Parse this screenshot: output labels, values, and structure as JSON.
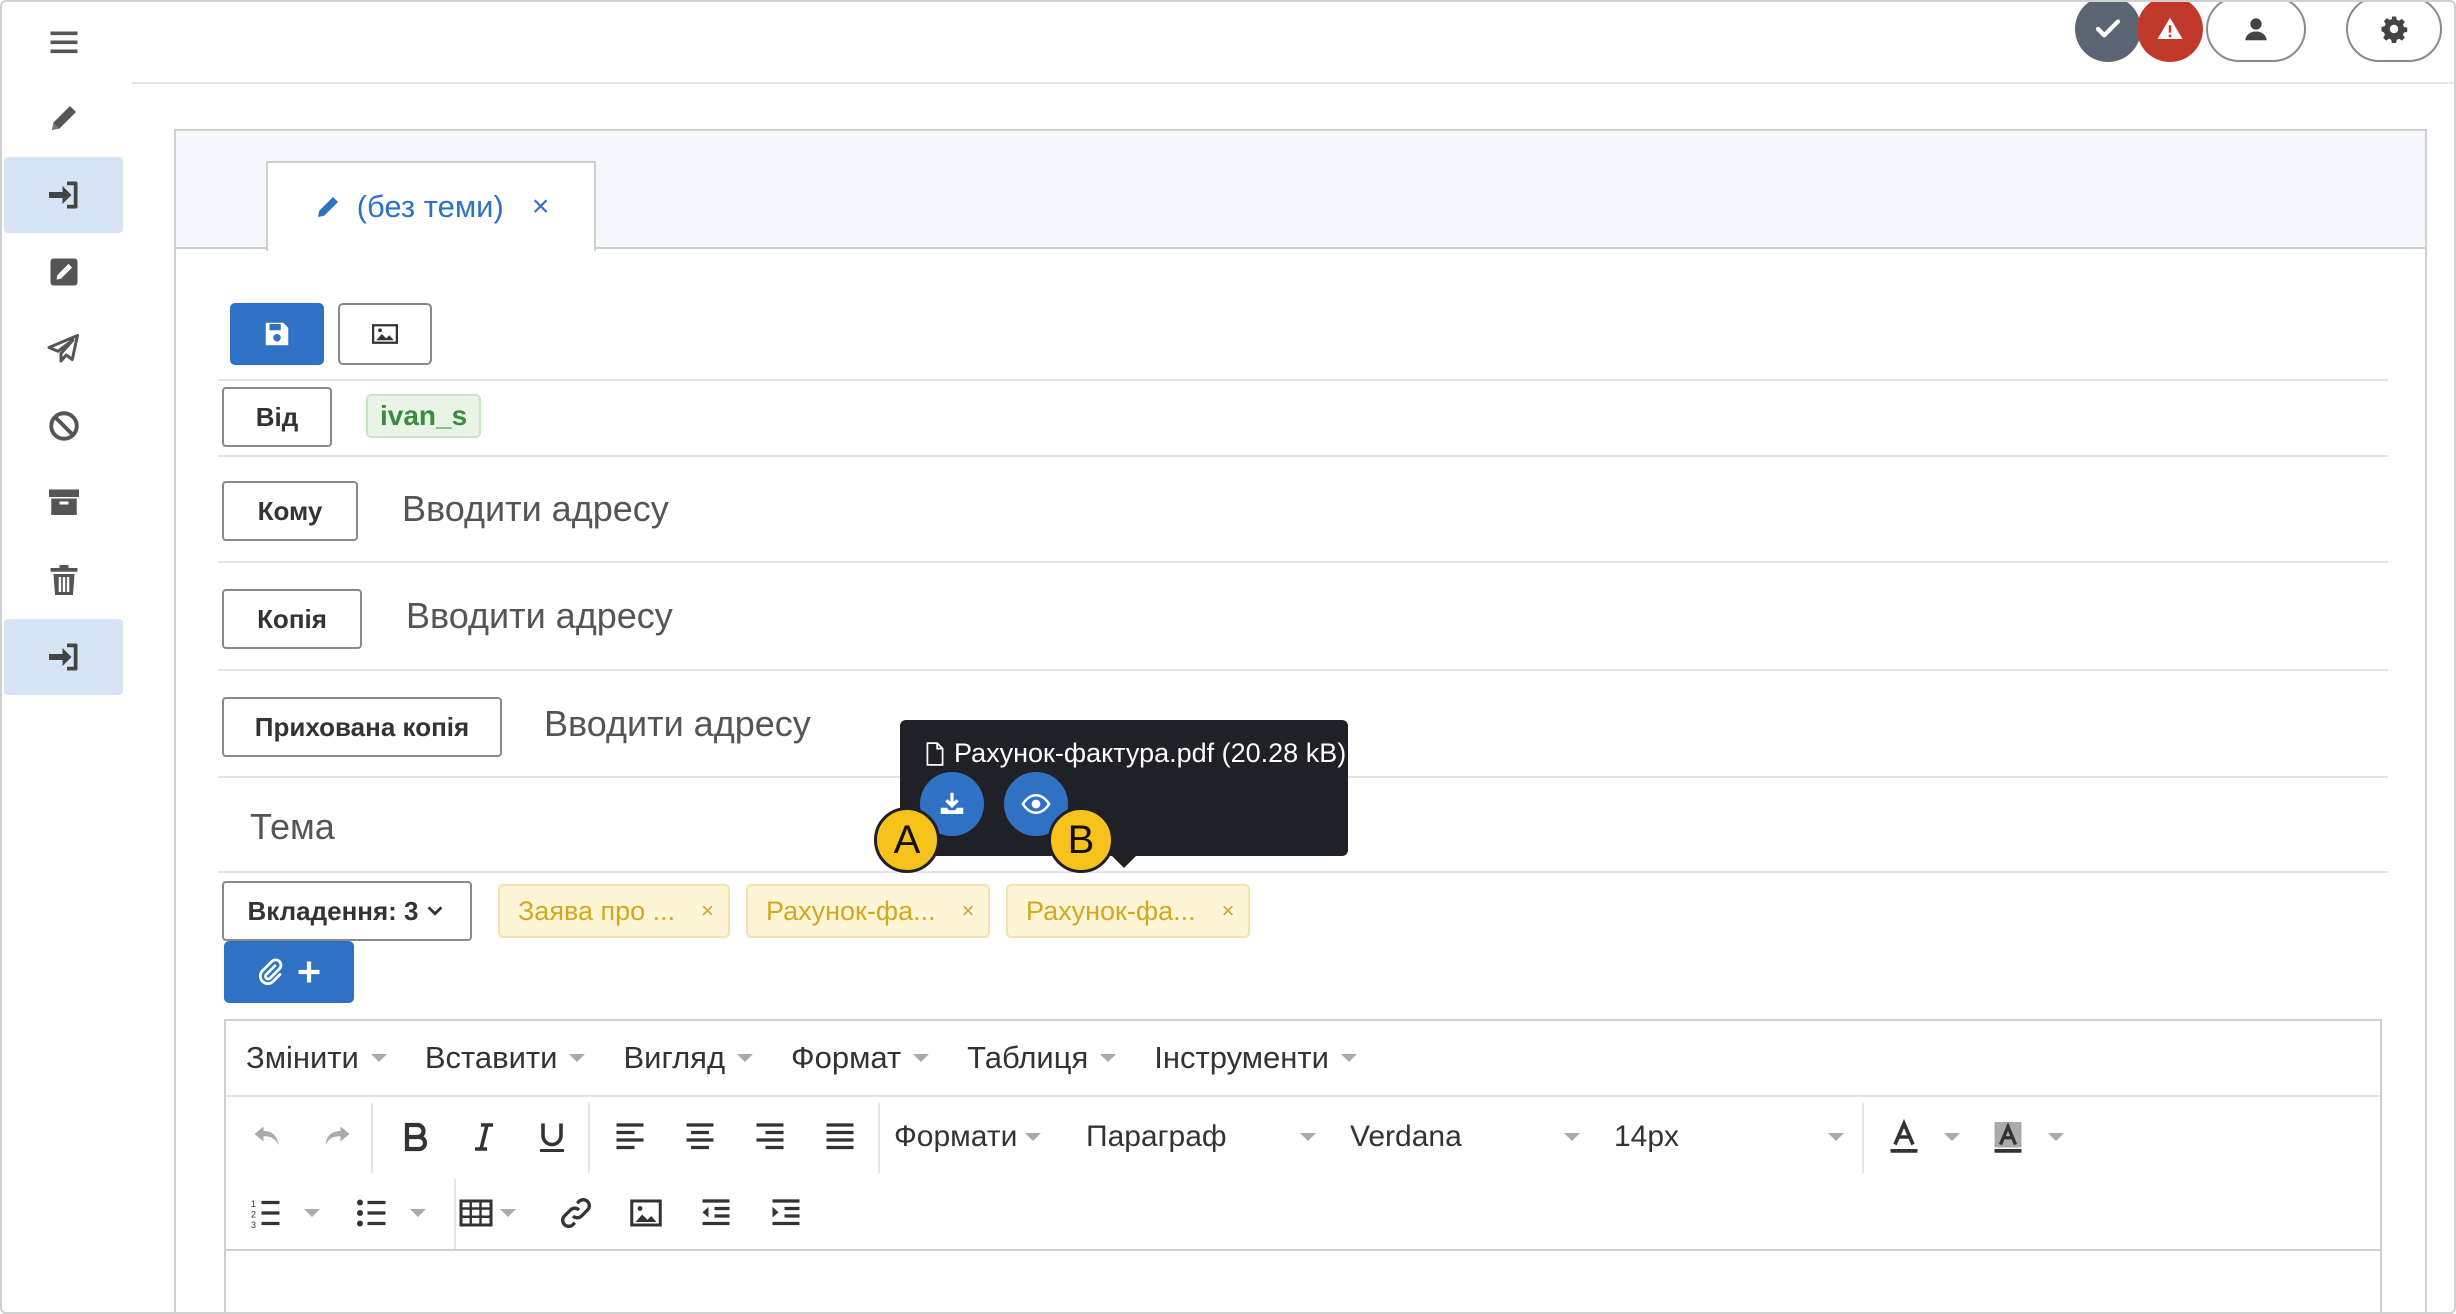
{
  "sidebar": {
    "items": [
      {
        "icon": "hamburger-icon"
      },
      {
        "icon": "pencil-icon"
      },
      {
        "icon": "sign-in-icon"
      },
      {
        "icon": "edit-square-icon"
      },
      {
        "icon": "paper-plane-icon"
      },
      {
        "icon": "ban-icon"
      },
      {
        "icon": "archive-icon"
      },
      {
        "icon": "trash-icon"
      },
      {
        "icon": "sign-in-icon"
      }
    ]
  },
  "topbar": {
    "icons": [
      "check-icon",
      "warning-icon",
      "user-icon",
      "gear-icon"
    ],
    "colors": {
      "check": "#5c6573",
      "warning": "#c0392b"
    }
  },
  "tab": {
    "label": "(без теми)",
    "close": "×"
  },
  "form": {
    "from_label": "Від",
    "from_user": "ivan_s",
    "to_label": "Кому",
    "to_placeholder": "Вводити адресу",
    "cc_label": "Копія",
    "cc_placeholder": "Вводити адресу",
    "bcc_label": "Прихована копія",
    "bcc_placeholder": "Вводити адресу",
    "subject_placeholder": "Тема",
    "attachments_label": "Вкладення: 3",
    "attachments": [
      {
        "name": "Заява про ...",
        "remove": "×"
      },
      {
        "name": "Рахунок-фа...",
        "remove": "×"
      },
      {
        "name": "Рахунок-фа...",
        "remove": "×"
      }
    ]
  },
  "tooltip": {
    "file": "Рахунок-фактура.pdf (20.28 kB)",
    "marker_a": "A",
    "marker_b": "B"
  },
  "editor": {
    "menu": [
      "Змінити",
      "Вставити",
      "Вигляд",
      "Формат",
      "Таблиця",
      "Інструменти"
    ],
    "formats_label": "Формати",
    "block_label": "Параграф",
    "font_label": "Verdana",
    "size_label": "14px"
  },
  "colors": {
    "accent": "#2f72c4",
    "chip_yellow": "#fdf5d6",
    "chip_green": "#eaf4e6",
    "tooltip_bg": "#1f2127",
    "marker": "#f8c21d"
  }
}
